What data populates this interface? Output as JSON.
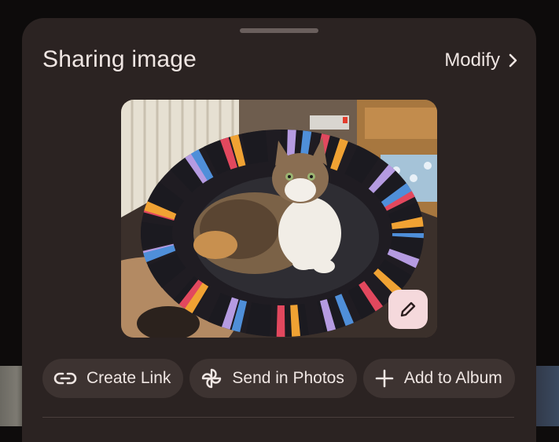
{
  "sheet": {
    "title": "Sharing image",
    "modify_label": "Modify"
  },
  "preview": {
    "icon": "pencil-icon"
  },
  "actions": [
    {
      "label": "Create Link",
      "icon": "link-icon"
    },
    {
      "label": "Send in Photos",
      "icon": "pinwheel-icon"
    },
    {
      "label": "Add to Album",
      "icon": "plus-icon"
    }
  ],
  "colors": {
    "sheet_background": "#2b2322",
    "chip_background": "#3d3331",
    "edit_button": "#f5d9dc",
    "text": "#efe6e3"
  }
}
